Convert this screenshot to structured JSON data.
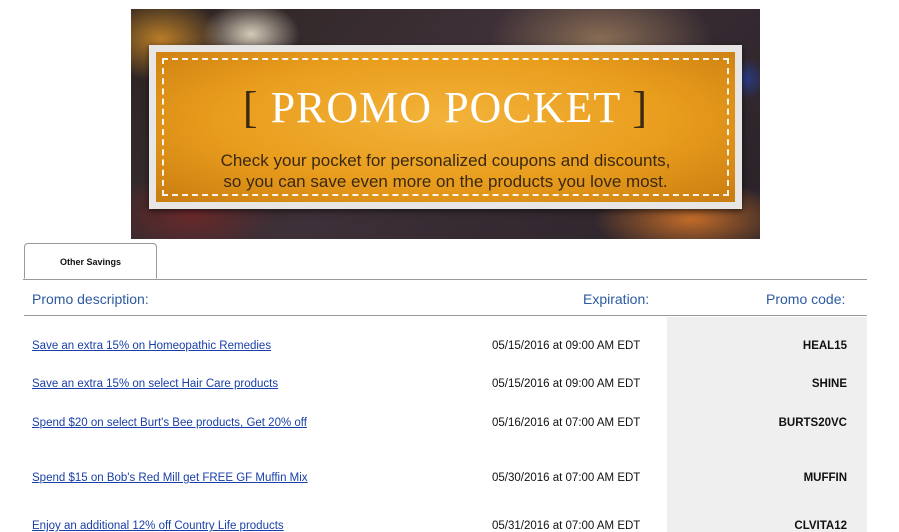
{
  "banner": {
    "title": "PROMO POCKET",
    "bracket_left": "[",
    "bracket_right": "]",
    "subtitle_line1": "Check your pocket for personalized coupons and discounts,",
    "subtitle_line2": "so you can save even more on the products you love most."
  },
  "tabs": [
    {
      "label": "Other Savings",
      "active": true
    }
  ],
  "table": {
    "headers": {
      "description": "Promo description:",
      "expiration": "Expiration:",
      "code": "Promo code:"
    },
    "rows": [
      {
        "description": "Save an extra 15% on Homeopathic Remedies",
        "expiration": "05/15/2016 at 09:00 AM EDT",
        "code": "HEAL15"
      },
      {
        "description": "Save an extra 15% on select Hair Care products",
        "expiration": "05/15/2016 at 09:00 AM EDT",
        "code": "SHINE"
      },
      {
        "description": "Spend $20 on select Burt's Bee products, Get 20% off",
        "expiration": "05/16/2016 at 07:00 AM EDT",
        "code": "BURTS20VC"
      },
      {
        "description": "Spend $15 on Bob's Red Mill get FREE GF Muffin Mix",
        "expiration": "05/30/2016 at 07:00 AM EDT",
        "code": "MUFFIN"
      },
      {
        "description": "Enjoy an additional 12% off Country Life products",
        "expiration": "05/31/2016 at 07:00 AM EDT",
        "code": "CLVITA12"
      }
    ]
  },
  "colors": {
    "header_text": "#2d5aa0",
    "link": "#1a3fa8",
    "banner_orange": "#e99d1d",
    "code_column_bg": "#efefef"
  }
}
